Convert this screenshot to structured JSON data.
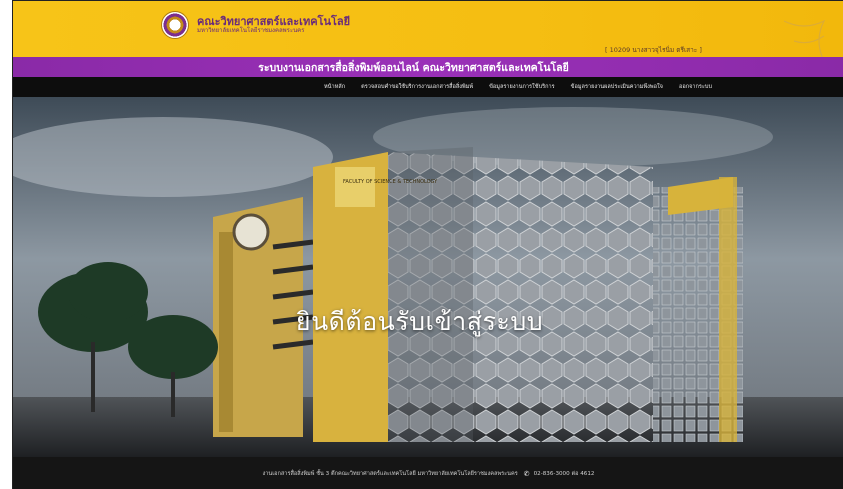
{
  "header": {
    "org_name": "คณะวิทยาศาสตร์และเทคโนโลยี",
    "org_sub": "มหาวิทยาลัยเทคโนโลยีราชมงคลพระนคร",
    "user_info": "[ 10209 นางสาวจุไรนิ่ม ตรีเสาะ ]"
  },
  "system_title": "ระบบงานเอกสารสื่อสิ่งพิมพ์ออนไลน์ คณะวิทยาศาสตร์และเทคโนโลยี",
  "nav": {
    "items": [
      "หน้าหลัก",
      "ตรวจสอบคำขอใช้บริการงานเอกสารสื่อสิ่งพิมพ์",
      "ข้อมูลรายงานการใช้บริการ",
      "ข้อมูลรายงานผลประเมินความพึงพอใจ",
      "ออกจากระบบ"
    ]
  },
  "hero": {
    "welcome": "ยินดีต้อนรับเข้าสู่ระบบ",
    "building_sign": "FACULTY OF SCIENCE & TECHNOLOGY"
  },
  "footer": {
    "address": "งานเอกสารสื่อสิ่งพิมพ์ ชั้น 3 ตึกคณะวิทยาศาสตร์และเทคโนโลยี มหาวิทยาลัยเทคโนโลยีราชมงคลพระนคร",
    "phone_icon": "phone-icon",
    "phone": "02-836-3000 ต่อ 4612"
  },
  "colors": {
    "header_yellow": "#f5be12",
    "title_purple": "#9a30b8",
    "nav_black": "#0d0d0d"
  }
}
